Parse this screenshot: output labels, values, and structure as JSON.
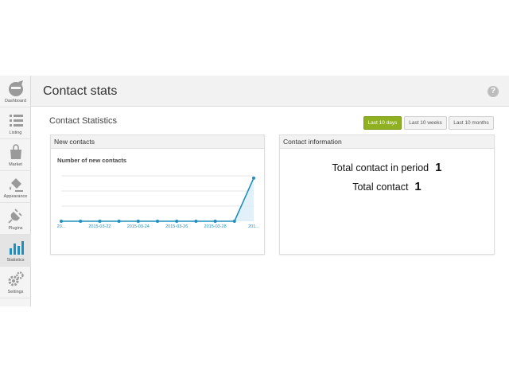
{
  "sidebar": {
    "items": [
      {
        "label": "Dashboard",
        "icon": "dashboard-icon"
      },
      {
        "label": "Listing",
        "icon": "list-icon"
      },
      {
        "label": "Market",
        "icon": "shopping-bag-icon"
      },
      {
        "label": "Appearance",
        "icon": "paint-bucket-icon"
      },
      {
        "label": "Plugins",
        "icon": "plug-icon"
      },
      {
        "label": "Statistics",
        "icon": "bar-chart-icon",
        "active": true
      },
      {
        "label": "Settings",
        "icon": "gears-icon"
      }
    ]
  },
  "header": {
    "title": "Contact stats",
    "help": "?"
  },
  "section": {
    "title": "Contact Statistics"
  },
  "range_buttons": [
    {
      "label": "Last 10 days",
      "active": true
    },
    {
      "label": "Last 10 weeks",
      "active": false
    },
    {
      "label": "Last 10 months",
      "active": false
    }
  ],
  "new_contacts": {
    "panel_title": "New contacts",
    "chart_title": "Number of new contacts"
  },
  "contact_info": {
    "panel_title": "Contact information",
    "rows": [
      {
        "label": "Total contact in period",
        "value": "1"
      },
      {
        "label": "Total contact",
        "value": "1"
      }
    ]
  },
  "colors": {
    "accent": "#8fb021",
    "line": "#1f8fbf",
    "area": "#dbeef7"
  },
  "chart_data": {
    "type": "area",
    "x": [
      "2015-03-20",
      "2015-03-21",
      "2015-03-22",
      "2015-03-23",
      "2015-03-24",
      "2015-03-25",
      "2015-03-26",
      "2015-03-27",
      "2015-03-28",
      "2015-03-29",
      "2015-03-30"
    ],
    "x_tick_labels": [
      "20...",
      "2015-03-22",
      "2015-03-24",
      "2015-03-26",
      "2015-03-28",
      "201..."
    ],
    "x_tick_indices": [
      0,
      2,
      4,
      6,
      8,
      10
    ],
    "values": [
      0,
      0,
      0,
      0,
      0,
      0,
      0,
      0,
      0,
      0,
      1
    ],
    "ylim": [
      0,
      1.4
    ],
    "grid": true,
    "title": "Number of new contacts"
  }
}
